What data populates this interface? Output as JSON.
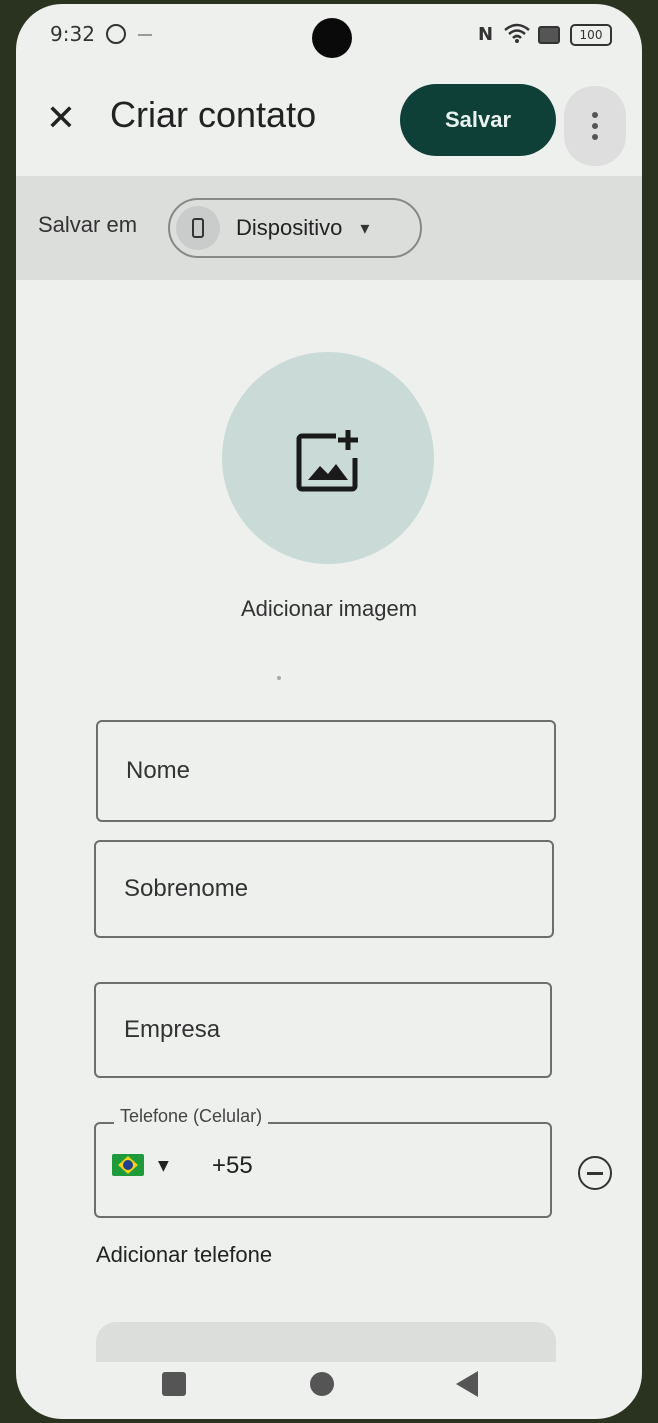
{
  "status_bar": {
    "time": "9:32",
    "battery": "100"
  },
  "app_bar": {
    "title": "Criar contato",
    "save_label": "Salvar"
  },
  "save_in": {
    "label": "Salvar em",
    "value": "Dispositivo"
  },
  "image": {
    "label": "Adicionar imagem"
  },
  "fields": {
    "first_name": "Nome",
    "last_name": "Sobrenome",
    "company": "Empresa"
  },
  "phone": {
    "label": "Telefone (Celular)",
    "value": "+55"
  },
  "add_phone": "Adicionar telefone",
  "colors": {
    "save_button": "#0f4038",
    "avatar_bg": "#cadbd7",
    "background": "#eef0ee"
  }
}
